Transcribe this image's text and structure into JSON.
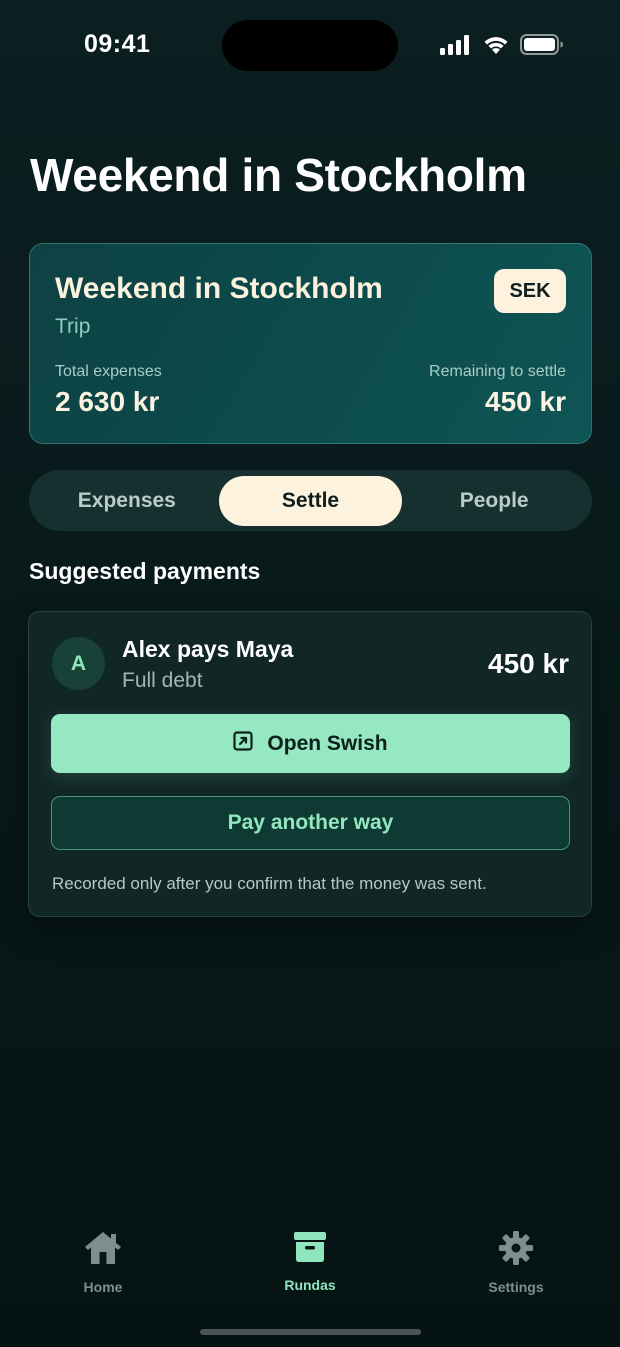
{
  "status_bar": {
    "time": "09:41",
    "icons": [
      "cellular-signal-icon",
      "wifi-icon",
      "battery-icon"
    ]
  },
  "page": {
    "title": "Weekend in Stockholm"
  },
  "trip_card": {
    "name": "Weekend in Stockholm",
    "type": "Trip",
    "currency": "SEK",
    "total_label": "Total expenses",
    "total_value": "2 630 kr",
    "remaining_label": "Remaining to settle",
    "remaining_value": "450 kr"
  },
  "tabs": [
    {
      "label": "Expenses",
      "active": false
    },
    {
      "label": "Settle",
      "active": true
    },
    {
      "label": "People",
      "active": false
    }
  ],
  "suggested": {
    "section_title": "Suggested payments",
    "payment": {
      "avatar_initial": "A",
      "title": "Alex pays Maya",
      "note": "Full debt",
      "amount": "450 kr",
      "primary_button": "Open Swish",
      "primary_icon": "external-link-icon",
      "secondary_button": "Pay another way",
      "footnote": "Recorded only after you confirm that the money was sent."
    }
  },
  "bottom_nav": [
    {
      "label": "Home",
      "icon": "home-icon",
      "active": false
    },
    {
      "label": "Rundas",
      "icon": "archive-box-icon",
      "active": true
    },
    {
      "label": "Settings",
      "icon": "gear-icon",
      "active": false
    }
  ],
  "colors": {
    "background": "#081819",
    "accent_green": "#95e8c1",
    "cream": "#fcf2de",
    "card_teal": "#0c4a4b"
  }
}
